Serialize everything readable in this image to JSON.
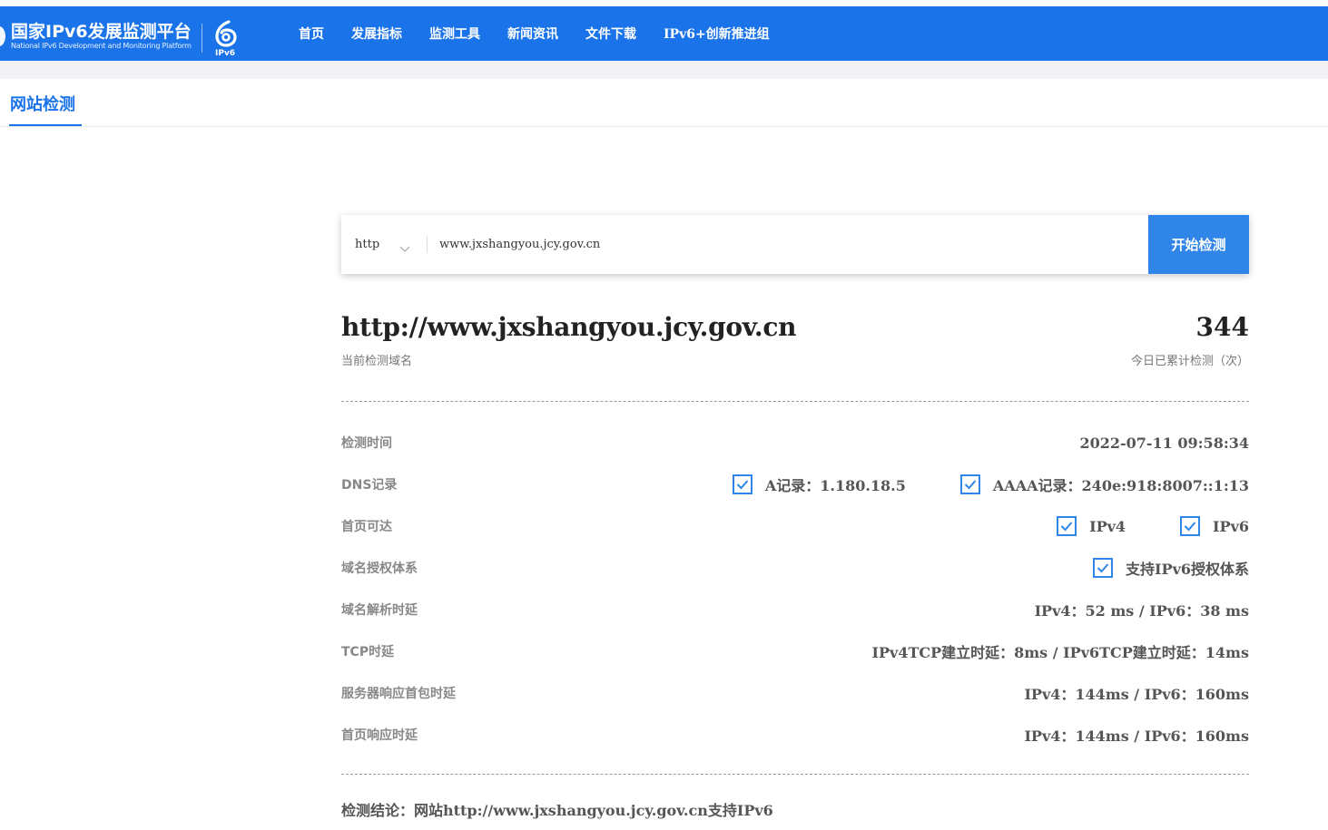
{
  "header": {
    "logo_cn": "国家IPv6发展监测平台",
    "logo_en": "National IPv6 Development and Monitoring Platform",
    "badge": "IPv6",
    "nav": [
      {
        "label": "首页"
      },
      {
        "label": "发展指标"
      },
      {
        "label": "监测工具"
      },
      {
        "label": "新闻资讯"
      },
      {
        "label": "文件下载"
      },
      {
        "label": "IPv6+创新推进组"
      }
    ]
  },
  "tab": {
    "label": "网站检测"
  },
  "search": {
    "protocol": "http",
    "value": "www.jxshangyou.jcy.gov.cn",
    "button": "开始检测"
  },
  "summary": {
    "domain": "http://www.jxshangyou.jcy.gov.cn",
    "domain_caption": "当前检测域名",
    "count": "344",
    "count_caption": "今日已累计检测（次）"
  },
  "details": {
    "time": {
      "label": "检测时间",
      "value": "2022-07-11 09:58:34"
    },
    "dns": {
      "label": "DNS记录",
      "a": "A记录：1.180.18.5",
      "aaaa": "AAAA记录：240e:918:8007::1:13"
    },
    "reach": {
      "label": "首页可达",
      "ipv4": "IPv4",
      "ipv6": "IPv6"
    },
    "auth": {
      "label": "域名授权体系",
      "value": "支持IPv6授权体系"
    },
    "resolve": {
      "label": "域名解析时延",
      "value": "IPv4：52 ms / IPv6：38 ms"
    },
    "tcp": {
      "label": "TCP时延",
      "value": "IPv4TCP建立时延：8ms / IPv6TCP建立时延：14ms"
    },
    "server": {
      "label": "服务器响应首包时延",
      "value": "IPv4：144ms / IPv6：160ms"
    },
    "page": {
      "label": "首页响应时延",
      "value": "IPv4：144ms / IPv6：160ms"
    }
  },
  "conclusion": "检测结论：网站http://www.jxshangyou.jcy.gov.cn支持IPv6"
}
